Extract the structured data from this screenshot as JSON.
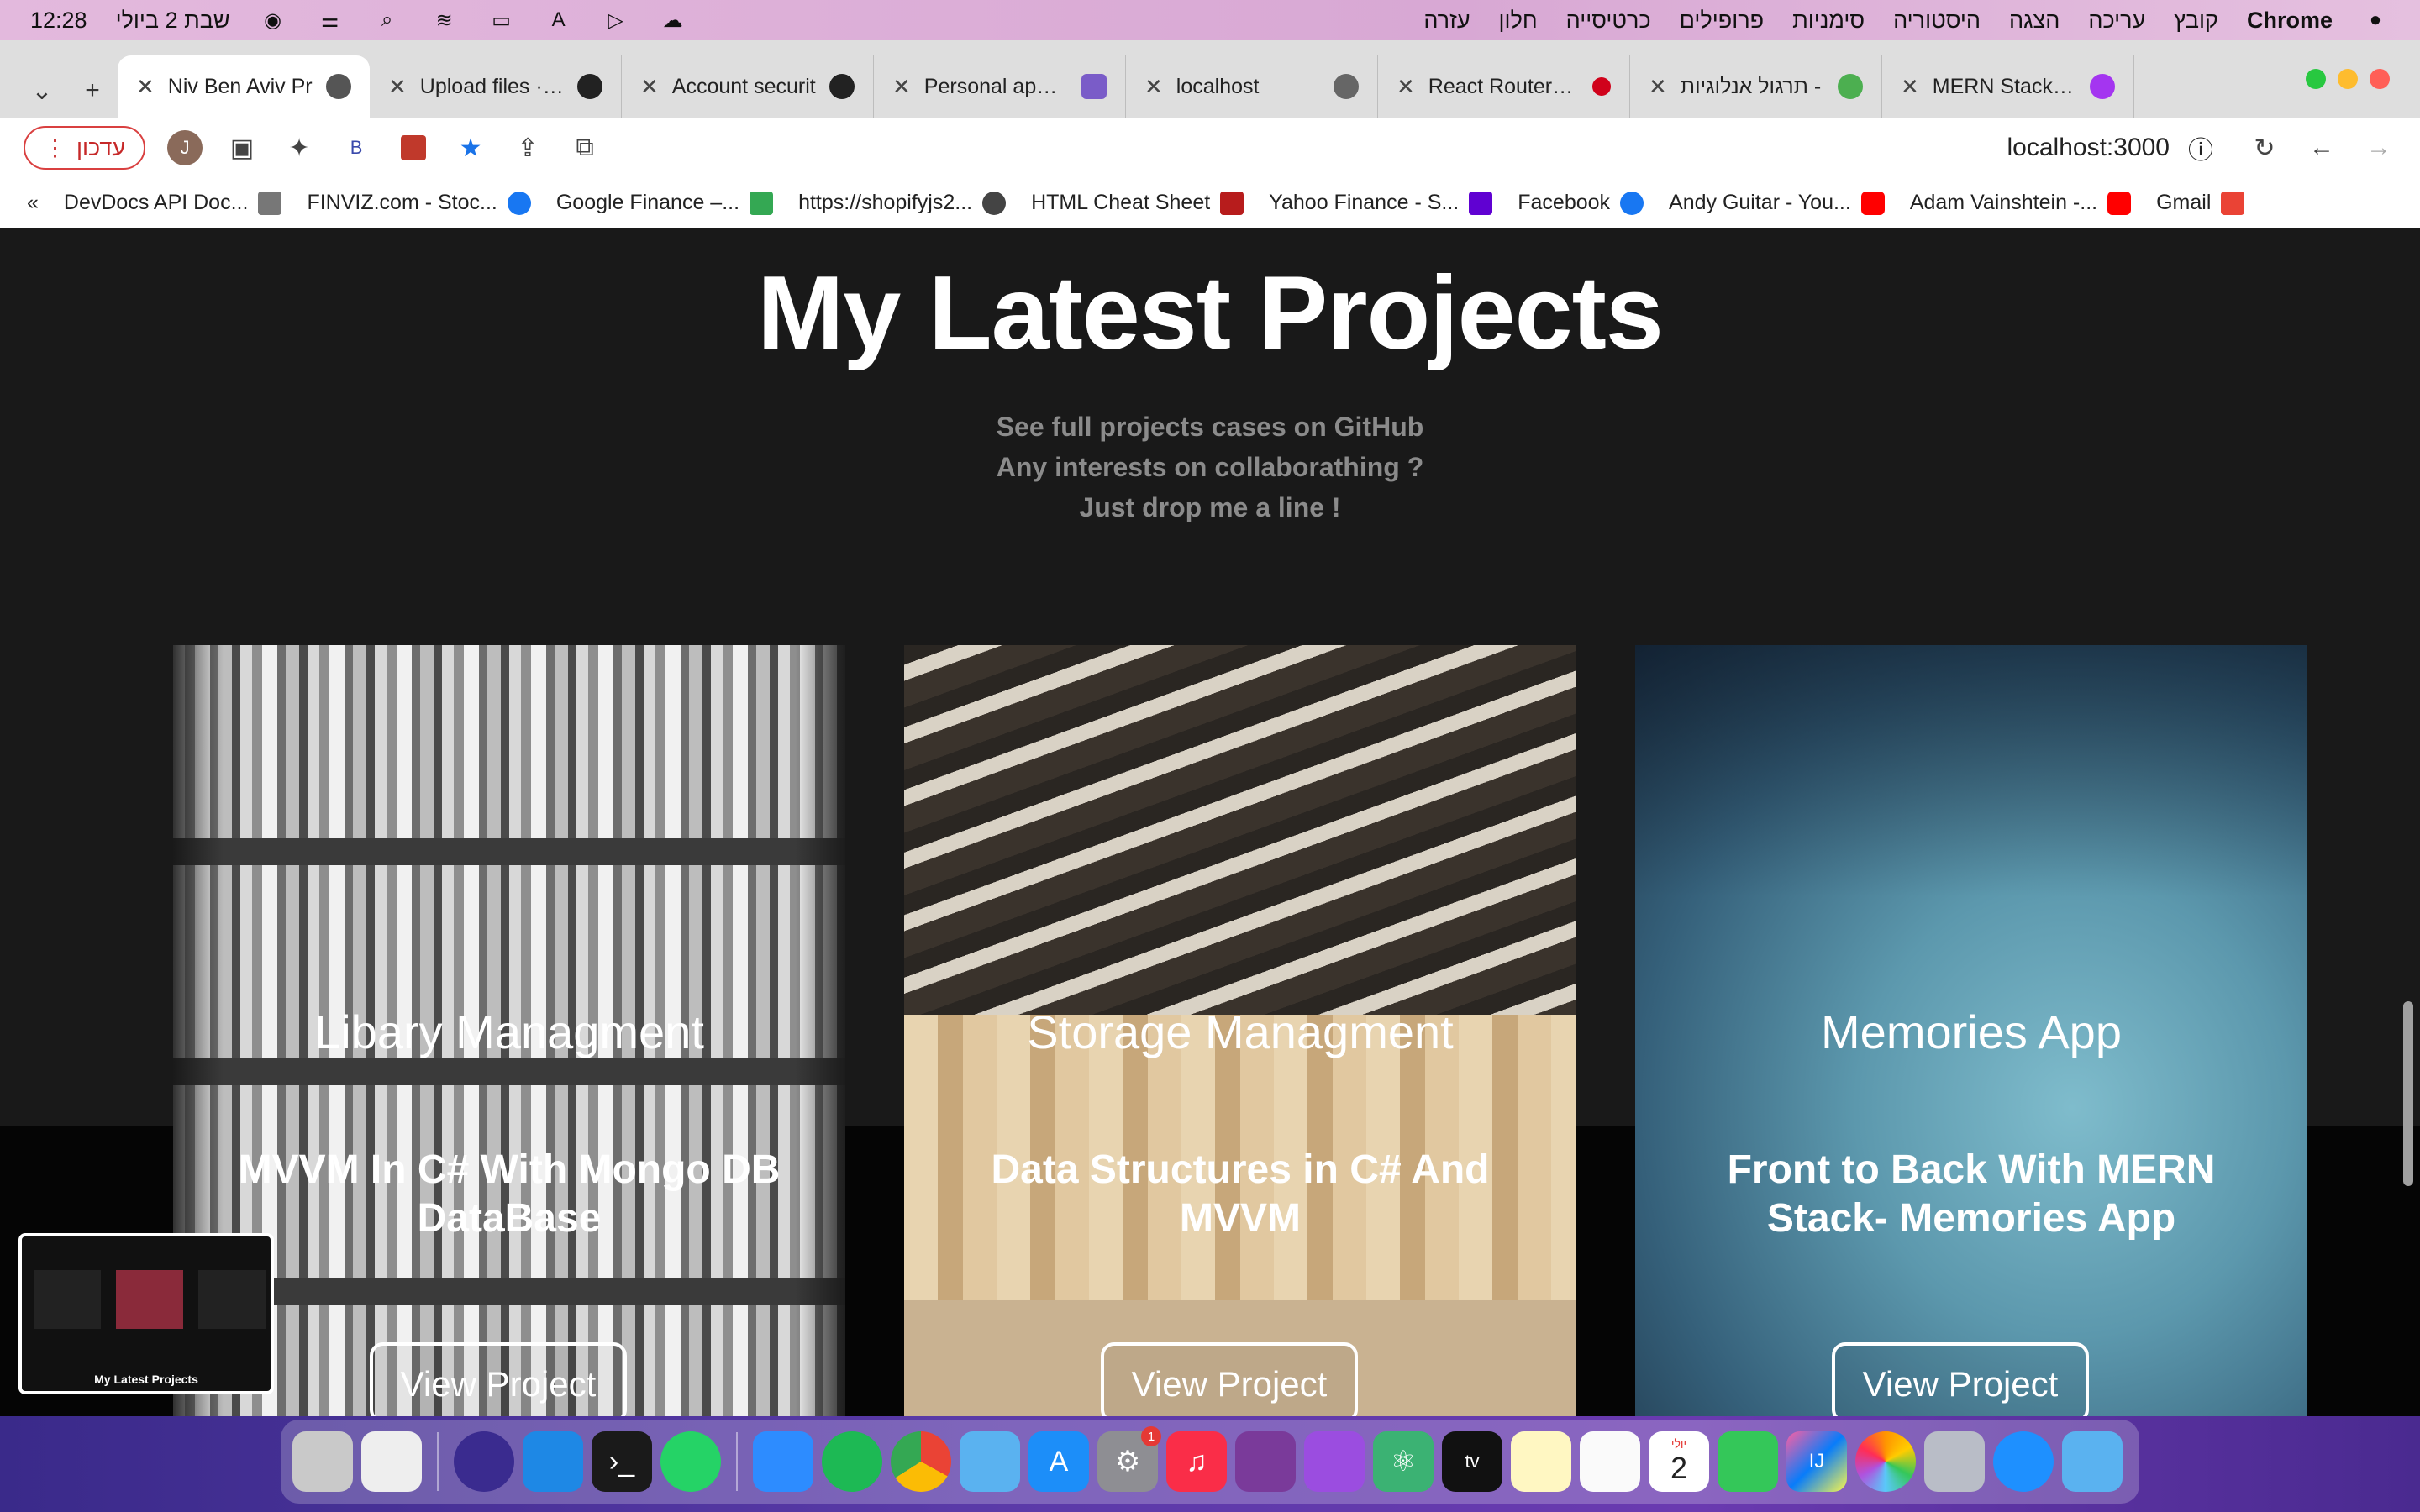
{
  "menubar": {
    "time": "12:28",
    "date": "שבת 2 ביולי",
    "items": [
      "עזרה",
      "חלון",
      "כרטיסייה",
      "פרופילים",
      "סימניות",
      "היסטוריה",
      "הצגה",
      "עריכה",
      "קובץ"
    ],
    "app": "Chrome"
  },
  "tabs": [
    {
      "title": "Niv Ben Aviv Pr",
      "active": true
    },
    {
      "title": "Upload files · Ni"
    },
    {
      "title": "Account securit"
    },
    {
      "title": "Personal apps |"
    },
    {
      "title": "localhost"
    },
    {
      "title": "React Router | C"
    },
    {
      "title": "תרגול אנלוגיות -"
    },
    {
      "title": "MERN Stack Co"
    }
  ],
  "toolbar": {
    "update_label": "עדכון",
    "avatar_letter": "J",
    "extension_b": "B",
    "url": "localhost:3000"
  },
  "bookmarks": [
    "DevDocs API Doc...",
    "FINVIZ.com - Stoc...",
    "Google Finance –...",
    "https://shopifyjs2...",
    "HTML Cheat Sheet",
    "Yahoo Finance - S...",
    "Facebook",
    "Andy Guitar - You...",
    "Adam Vainshtein -...",
    "Gmail"
  ],
  "page": {
    "heading": "My Latest Projects",
    "sub1": "See full projects cases on GitHub",
    "sub2": "Any interests on collaborathing ?",
    "sub3": "Just drop me a line !",
    "projects": [
      {
        "title": "Libary Managment",
        "desc": "MVVM In C# With Mongo DB DataBase",
        "button": "View Project"
      },
      {
        "title": "Storage Managment",
        "desc": "Data Structures in C# And MVVM",
        "button": "View Project"
      },
      {
        "title": "Memories App",
        "desc": "Front to Back With MERN Stack- Memories App",
        "button": "View Project"
      }
    ],
    "pip_text": "My Latest Projects"
  },
  "dock": {
    "calendar_month": "יולי",
    "calendar_day": "2",
    "settings_badge": "1"
  },
  "colors": {
    "page_bg": "#191919",
    "update_red": "#c62828",
    "star_blue": "#1a73e8"
  }
}
